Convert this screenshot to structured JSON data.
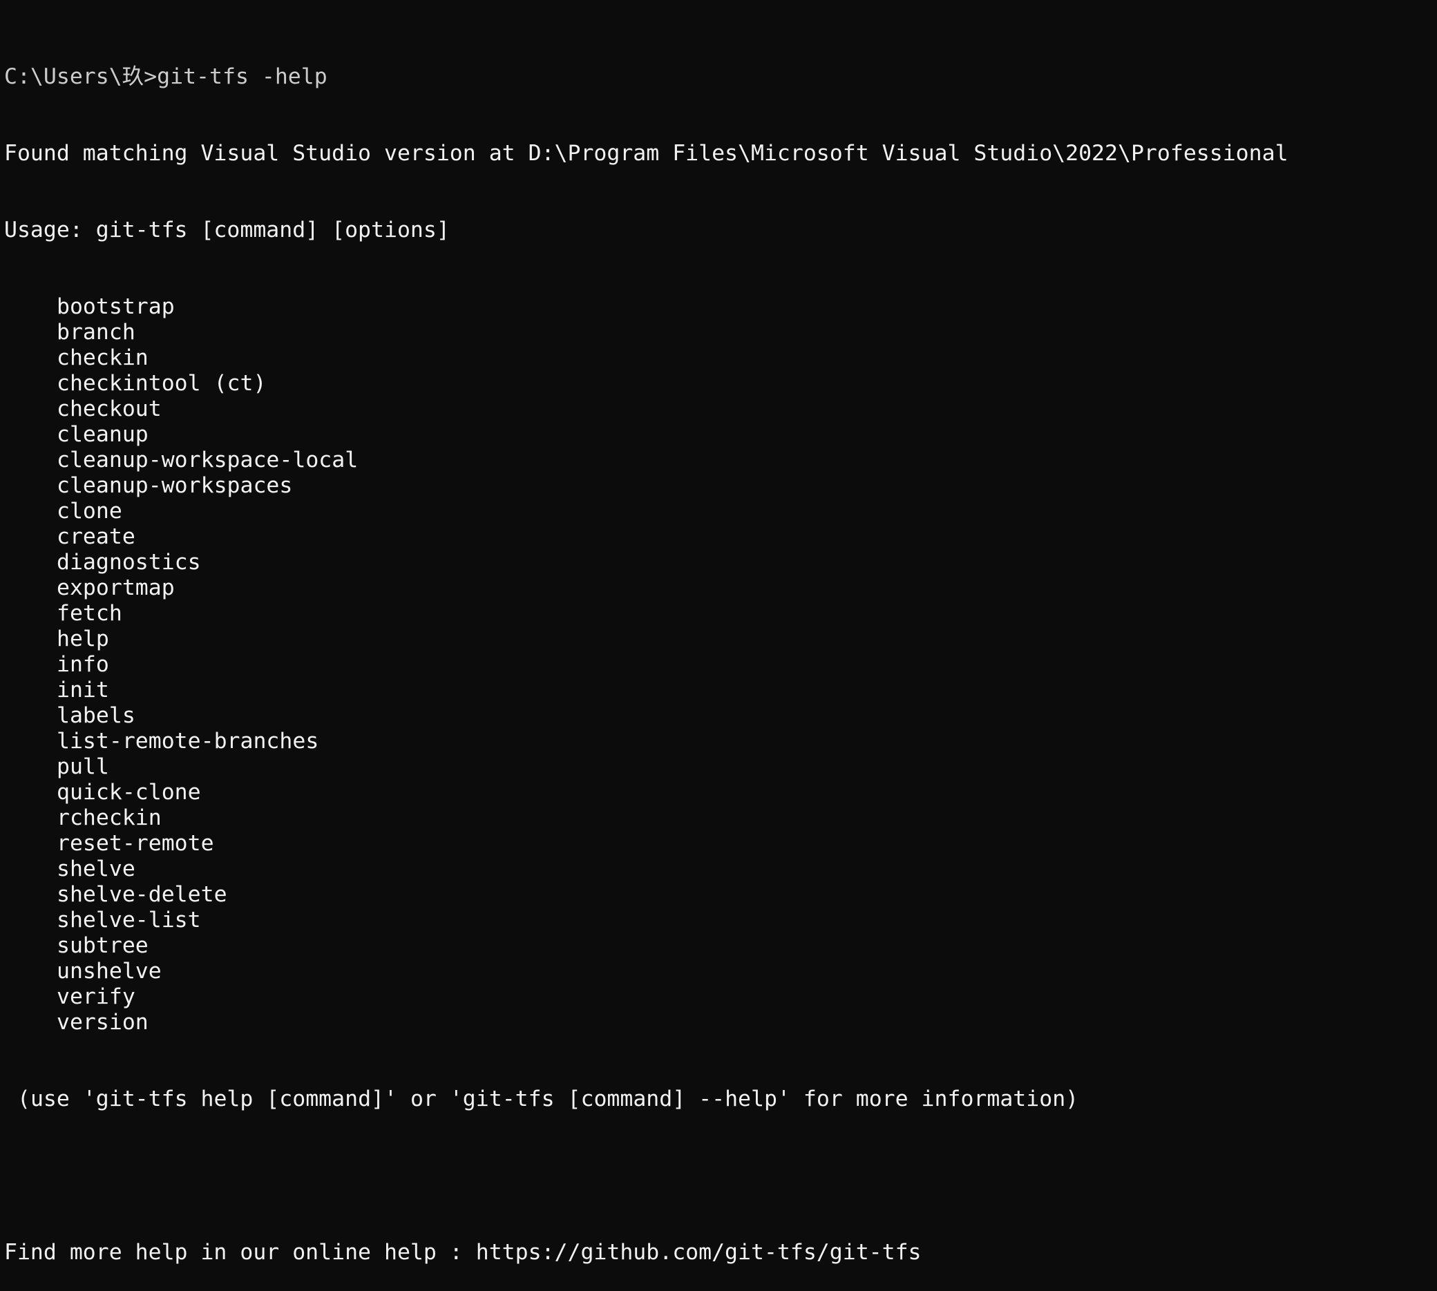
{
  "terminal": {
    "prompt": "C:\\Users\\玖>",
    "command": "git-tfs -help",
    "found_line": "Found matching Visual Studio version at D:\\Program Files\\Microsoft Visual Studio\\2022\\Professional",
    "usage_line": "Usage: git-tfs [command] [options]",
    "commands": [
      "bootstrap",
      "branch",
      "checkin",
      "checkintool (ct)",
      "checkout",
      "cleanup",
      "cleanup-workspace-local",
      "cleanup-workspaces",
      "clone",
      "create",
      "diagnostics",
      "exportmap",
      "fetch",
      "help",
      "info",
      "init",
      "labels",
      "list-remote-branches",
      "pull",
      "quick-clone",
      "rcheckin",
      "reset-remote",
      "shelve",
      "shelve-delete",
      "shelve-list",
      "subtree",
      "unshelve",
      "verify",
      "version"
    ],
    "usage_note": "(use 'git-tfs help [command]' or 'git-tfs [command] --help' for more information)",
    "online_help": "Find more help in our online help : https://github.com/git-tfs/git-tfs"
  },
  "colors": {
    "background": "#0c0c0c",
    "prompt_text": "#cccccc",
    "output_text": "#f2f2f2"
  }
}
